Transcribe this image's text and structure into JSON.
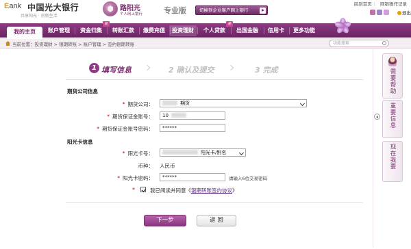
{
  "header": {
    "ebank_prefix": "E",
    "ebank_suffix": "ank",
    "bank_name": "中国光大银行",
    "slogan": "共享阳光 · 创新生活",
    "badge_title": "阳光",
    "badge_title_prefix": "路",
    "badge_sub": "个人网上银行",
    "edition": "专业版",
    "switch_label": "切换到企业客户网上银行",
    "links": [
      "回到首页",
      "网银操作记录"
    ],
    "exit_label": "退出",
    "theme_colors": [
      "#c070a8",
      "#9f86c7",
      "#d59be0",
      "#e2b54a"
    ]
  },
  "nav": {
    "items": [
      {
        "label": "我的主页",
        "new": false
      },
      {
        "label": "账户管理",
        "new": false
      },
      {
        "label": "资金归集",
        "new": true
      },
      {
        "label": "转账汇款",
        "new": false
      },
      {
        "label": "缴费充值",
        "new": false
      },
      {
        "label": "投资理财",
        "new": false
      },
      {
        "label": "个人贷款",
        "new": true
      },
      {
        "label": "出国金融",
        "new": false
      },
      {
        "label": "信用卡",
        "new": false
      },
      {
        "label": "更多功能",
        "new": false
      }
    ],
    "new_tag": "新"
  },
  "breadcrumb": {
    "text": "当前位置：投资理财 > 银期转账 > 账户管理 > 签约银期转账"
  },
  "search": {
    "placeholder": "功能搜索"
  },
  "steps": [
    {
      "num": "1",
      "label": "填写信息"
    },
    {
      "num": "2",
      "label": "确认及提交"
    },
    {
      "num": "3",
      "label": "完成"
    }
  ],
  "futures_section": {
    "title": "期货公司信息",
    "company_label": "期货公司：",
    "company_value": "期货",
    "margin_account_label": "期货保证金账号：",
    "margin_account_value": "10",
    "margin_pwd_label": "期货保证金账号密码：",
    "margin_pwd_value": "******"
  },
  "card_section": {
    "title": "阳光卡信息",
    "card_no_label": "阳光卡号：",
    "card_no_value": "阳光卡/别名",
    "currency_label": "币种：",
    "currency_value": "人民币",
    "card_pwd_label": "阳光卡密码：",
    "card_pwd_value": "******",
    "card_pwd_hint": "请输入6位交易密码"
  },
  "agreement": {
    "prefix": "我已阅读并同意《",
    "link": "银期转账签约协议",
    "suffix": "》"
  },
  "buttons": {
    "next": "下一步",
    "back": "返 回"
  },
  "sidebar": {
    "help": "需要帮助",
    "important": "重要信息",
    "now": "现在我要"
  }
}
